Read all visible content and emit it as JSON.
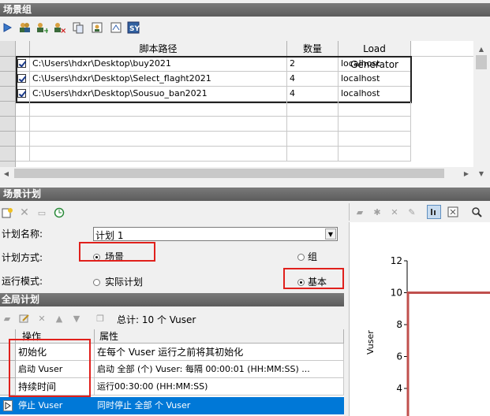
{
  "scene_group": {
    "title": "场景组",
    "columns": [
      "脚本路径",
      "数量",
      "Load Generator"
    ],
    "rows": [
      {
        "path": "C:\\Users\\hdxr\\Desktop\\buy2021",
        "count": "2",
        "lg": "localhost"
      },
      {
        "path": "C:\\Users\\hdxr\\Desktop\\Select_flaght2021",
        "count": "4",
        "lg": "localhost"
      },
      {
        "path": "C:\\Users\\hdxr\\Desktop\\Sousuo_ban2021",
        "count": "4",
        "lg": "localhost"
      }
    ]
  },
  "scene_plan": {
    "title": "场景计划",
    "plan_name_label": "计划名称:",
    "plan_name_value": "计划 1",
    "plan_method_label": "计划方式:",
    "option_scene": "场景",
    "option_group": "组",
    "run_mode_label": "运行模式:",
    "option_actual": "实际计划",
    "option_basic": "基本"
  },
  "global_plan": {
    "title": "全局计划",
    "total_text": "总计: 10 个 Vuser",
    "col_action": "操作",
    "col_property": "属性",
    "rows": [
      {
        "action": "初始化",
        "property": "在每个 Vuser 运行之前将其初始化"
      },
      {
        "action": "启动 Vuser",
        "property": "启动 全部 (个) Vuser: 每隔 00:00:01 (HH:MM:SS) ..."
      },
      {
        "action": "持续时间",
        "property": "运行00:30:00 (HH:MM:SS)"
      },
      {
        "action": "停止 Vuser",
        "property": "同时停止 全部 个 Vuser"
      }
    ]
  },
  "chart_data": {
    "type": "line",
    "ylabel": "Vuser",
    "y_ticks": [
      "12",
      "10",
      "8",
      "6",
      "4"
    ],
    "ylim": [
      3,
      12
    ],
    "series": [
      {
        "values": [
          10,
          10
        ]
      }
    ],
    "line_color": "#c0504d"
  }
}
